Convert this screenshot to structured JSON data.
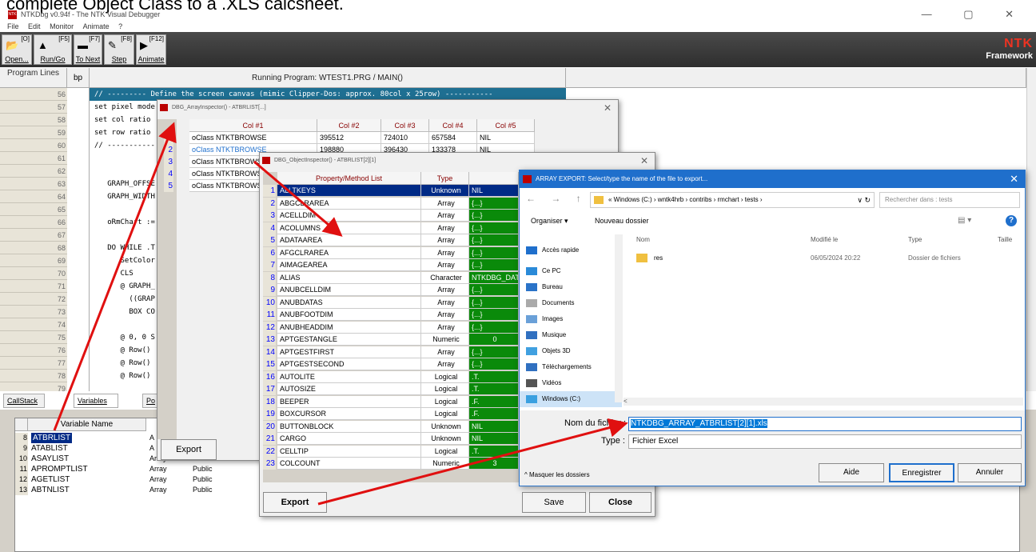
{
  "caption": "complete Object Class to a .XLS calcsheet.",
  "window": {
    "title": "NTKDbg v0.94f - The NTK Visual Debugger",
    "icon_text": "NTK",
    "controls": "—  ▢  ✕"
  },
  "menu": [
    "File",
    "Edit",
    "Monitor",
    "Animate",
    "?"
  ],
  "toolbar": [
    {
      "key": "[O]",
      "label": "Open..."
    },
    {
      "key": "[F5]",
      "label": "Run/Go"
    },
    {
      "key": "[F7]",
      "label": "To Next"
    },
    {
      "key": "[F8]",
      "label": "Step"
    },
    {
      "key": "[F12]",
      "label": "Animate"
    }
  ],
  "logo": {
    "line1": "NTK",
    "line2": "Framework"
  },
  "source": {
    "header_lines": "Program Lines",
    "header_bp": "bp",
    "header_title": "Running Program: WTEST1.PRG / MAIN()",
    "line_numbers": [
      "56",
      "57",
      "58",
      "59",
      "60",
      "61",
      "62",
      "63",
      "64",
      "65",
      "66",
      "67",
      "68",
      "69",
      "70",
      "71",
      "72",
      "73",
      "74",
      "75",
      "76",
      "77",
      "78",
      "79"
    ],
    "code": [
      "// --------- Define the screen canvas (mimic Clipper-Dos: approx. 80col x 25row) -----------",
      "set pixel mode",
      "set col ratio",
      "set row ratio",
      "// -----------",
      "",
      "",
      "   GRAPH_OFFSE",
      "   GRAPH_WIDTH",
      "",
      "   oRmChart :=",
      "",
      "   DO WHILE .T",
      "      SetColor",
      "      CLS",
      "      @ GRAPH_",
      "        ((GRAP",
      "        BOX CO",
      "",
      "      @ 0, 0 S",
      "      @ Row()",
      "      @ Row()",
      "      @ Row()",
      ""
    ]
  },
  "tabs": [
    "CallStack",
    "Variables",
    "Po"
  ],
  "variables": {
    "header_name": "Variable Name",
    "rows": [
      {
        "n": "8",
        "name": "ATBRLIST",
        "type": "A",
        "scope": ""
      },
      {
        "n": "9",
        "name": "ATABLIST",
        "type": "A",
        "scope": ""
      },
      {
        "n": "10",
        "name": "ASAYLIST",
        "type": "Array",
        "scope": "Public"
      },
      {
        "n": "11",
        "name": "APROMPTLIST",
        "type": "Array",
        "scope": "Public"
      },
      {
        "n": "12",
        "name": "AGETLIST",
        "type": "Array",
        "scope": "Public"
      },
      {
        "n": "13",
        "name": "ABTNLIST",
        "type": "Array",
        "scope": "Public"
      }
    ]
  },
  "array_inspector": {
    "title": "DBG_ArrayInspector() - ATBRLIST[...]",
    "headers": [
      "Col #1",
      "Col #2",
      "Col #3",
      "Col #4",
      "Col #5"
    ],
    "rows": [
      [
        "1",
        "oClass NTKTBROWSE",
        "395512",
        "724010",
        "657584",
        "NIL"
      ],
      [
        "2",
        "oClass NTKTBROWSE",
        "198880",
        "396430",
        "133378",
        "NIL"
      ],
      [
        "3",
        "oClass NTKTBROWSE",
        "",
        "",
        "",
        ""
      ],
      [
        "4",
        "oClass NTKTBROWSE",
        "",
        "",
        "",
        ""
      ],
      [
        "5",
        "oClass NTKTBROWSE",
        "",
        "",
        "",
        ""
      ]
    ],
    "export_label": "Export"
  },
  "object_inspector": {
    "title": "DBG_ObjectInspector() - ATBRLIST[2][1]",
    "header_prop": "Property/Method List",
    "header_type": "Type",
    "rows": [
      [
        "1",
        "ALLTKEYS",
        "Unknown",
        "NIL"
      ],
      [
        "2",
        "ABGCLRAREA",
        "Array",
        "{...}"
      ],
      [
        "3",
        "ACELLDIM",
        "Array",
        "{...}"
      ],
      [
        "4",
        "ACOLUMNS",
        "Array",
        "{...}"
      ],
      [
        "5",
        "ADATAAREA",
        "Array",
        "{...}"
      ],
      [
        "6",
        "AFGCLRAREA",
        "Array",
        "{...}"
      ],
      [
        "7",
        "AIMAGEAREA",
        "Array",
        "{...}"
      ],
      [
        "8",
        "ALIAS",
        "Character",
        "NTKDBG_DAT"
      ],
      [
        "9",
        "ANUBCELLDIM",
        "Array",
        "{...}"
      ],
      [
        "10",
        "ANUBDATAS",
        "Array",
        "{...}"
      ],
      [
        "11",
        "ANUBFOOTDIM",
        "Array",
        "{...}"
      ],
      [
        "12",
        "ANUBHEADDIM",
        "Array",
        "{...}"
      ],
      [
        "13",
        "APTGESTANGLE",
        "Numeric",
        "0"
      ],
      [
        "14",
        "APTGESTFIRST",
        "Array",
        "{...}"
      ],
      [
        "15",
        "APTGESTSECOND",
        "Array",
        "{...}"
      ],
      [
        "16",
        "AUTOLITE",
        "Logical",
        ".T."
      ],
      [
        "17",
        "AUTOSIZE",
        "Logical",
        ".T."
      ],
      [
        "18",
        "BEEPER",
        "Logical",
        ".F."
      ],
      [
        "19",
        "BOXCURSOR",
        "Logical",
        ".F."
      ],
      [
        "20",
        "BUTTONBLOCK",
        "Unknown",
        "NIL"
      ],
      [
        "21",
        "CARGO",
        "Unknown",
        "NIL"
      ],
      [
        "22",
        "CELLTIP",
        "Logical",
        ".T."
      ],
      [
        "23",
        "COLCOUNT",
        "Numeric",
        "3"
      ]
    ],
    "export_label": "Export",
    "save_label": "Save",
    "close_label": "Close"
  },
  "save_dialog": {
    "title": "ARRAY EXPORT: Select/type the name of the file to export...",
    "path": [
      "« Windows (C:)",
      "wntk4hrb",
      "contribs",
      "rmchart",
      "tests"
    ],
    "search_placeholder": "Rechercher dans : tests",
    "organize": "Organiser ▾",
    "new_folder": "Nouveau dossier",
    "nav": [
      "Accès rapide",
      "Ce PC",
      "Bureau",
      "Documents",
      "Images",
      "Musique",
      "Objets 3D",
      "Téléchargements",
      "Vidéos",
      "Windows (C:)"
    ],
    "col_name": "Nom",
    "col_modified": "Modifié le",
    "col_type": "Type",
    "col_size": "Taille",
    "files": [
      {
        "name": "res",
        "modified": "06/05/2024 20:22",
        "type": "Dossier de fichiers"
      }
    ],
    "filename_label": "Nom du fichier :",
    "filename_value": "NTKDBG_ARRAY_ATBRLIST[2][1].xls",
    "type_label": "Type :",
    "type_value": "Fichier Excel",
    "hide_folders": "Masquer les dossiers",
    "help_label": "Aide",
    "save_label": "Enregistrer",
    "cancel_label": "Annuler"
  },
  "colors": {
    "accent_red": "#e01010",
    "selection_blue": "#002a86",
    "green_cell": "#0a8a0a"
  }
}
